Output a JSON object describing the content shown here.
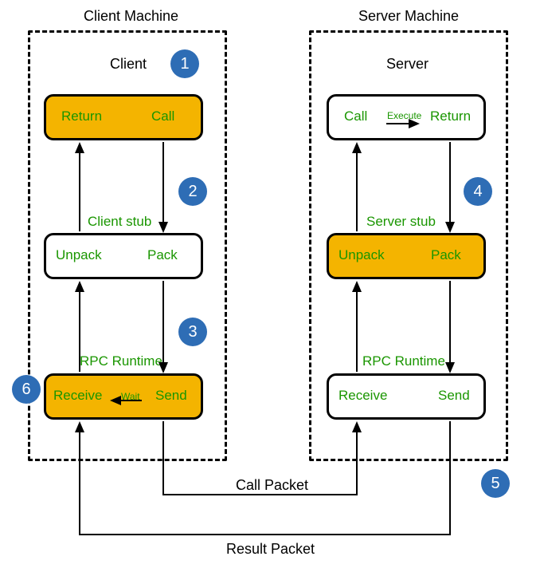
{
  "titles": {
    "client_machine": "Client Machine",
    "server_machine": "Server Machine",
    "client": "Client",
    "server": "Server"
  },
  "blocks": {
    "client_top": {
      "left": "Return",
      "right": "Call"
    },
    "client_stub_label": "Client stub",
    "client_mid": {
      "left": "Unpack",
      "right": "Pack"
    },
    "client_rpc_label": "RPC Runtime",
    "client_bot": {
      "left": "Receive",
      "mid": "Wait",
      "right": "Send"
    },
    "server_top": {
      "left": "Call",
      "mid": "Execute",
      "right": "Return"
    },
    "server_stub_label": "Server stub",
    "server_mid": {
      "left": "Unpack",
      "right": "Pack"
    },
    "server_rpc_label": "RPC Runtime",
    "server_bot": {
      "left": "Receive",
      "right": "Send"
    }
  },
  "steps": {
    "s1": "1",
    "s2": "2",
    "s3": "3",
    "s4": "4",
    "s5": "5",
    "s6": "6"
  },
  "packets": {
    "call": "Call Packet",
    "result": "Result Packet"
  },
  "colors": {
    "accent": "#f4b400",
    "text_green": "#1a9600",
    "step_blue": "#2e6db5"
  }
}
